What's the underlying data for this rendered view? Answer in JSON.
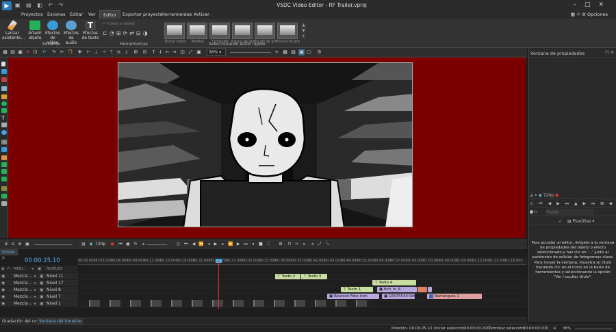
{
  "app": {
    "title": "VSDC Video Editor - RF Trailer.vproj",
    "logo_icon": "vsdc-logo-icon",
    "window_controls": [
      "minimize-icon",
      "maximize-icon",
      "close-icon"
    ]
  },
  "menu": {
    "items": [
      "Proyectos",
      "Escenas",
      "Editar",
      "Ver",
      "Editor",
      "Exportar proyecto",
      "Herramientas",
      "Activar"
    ],
    "active": "Editor",
    "options_label": "Opciones"
  },
  "ribbon": {
    "wizard_label": "Lanzar asistente...",
    "add_object_label": "Añadir objeto",
    "video_effects_label": "Efectos de vídeo",
    "audio_effects_label": "Efectos de audio",
    "text_effects_label": "Efectos de texto",
    "editing_group_label": "Editando",
    "cut_split_label": "Cortar y dividir",
    "tools_group_label": "Herramientas",
    "styles": [
      "Quitar todos",
      "Niveles",
      "Contraste",
      "Escala de gris",
      "Escala de gris",
      "Escala de gris"
    ],
    "quick_style_group_label": "Seleccionando estilo rápido"
  },
  "toolbar": {
    "zoom_value": "36%"
  },
  "properties": {
    "title": "Ventana de propiedades",
    "resolution": "720p",
    "point_placeholder": "Punto",
    "templates_label": "Plantillas",
    "help_text_1": "Para acceder al editor, dirígete a la ventana de propiedades del objeto o efecto seleccionado y haz clic en '...' junto al parámetro de edición de fotogramas clave.",
    "help_text_2": "Para mover la ventana, muestra su título haciendo clic en el icono en la barra de herramientas y seleccionando la opción \"Ver / ocultar título\"."
  },
  "playback": {
    "resolution": "720p"
  },
  "timeline": {
    "scene_tab": "Scene 0",
    "timecode": "00:00:25.10",
    "header_mode": "MOD...",
    "header_levels": "NIVELES",
    "ticks": [
      "00:00.000",
      "00:03.000",
      "00:06.000",
      "00:09.000",
      "00:12.000",
      "00:15.000",
      "00:18.000",
      "00:21.000",
      "00:24.000",
      "00:27.000",
      "00:30.000",
      "00:33.000",
      "00:36.000",
      "00:39.000",
      "00:42.000",
      "00:45.000",
      "00:48.000",
      "00:51.000",
      "00:54.000",
      "00:57.000",
      "01:00.000",
      "01:03.000",
      "01:06.000",
      "01:09.000",
      "01:12.000",
      "01:15.000",
      "01:18.000"
    ],
    "tracks": [
      {
        "mode": "Mezcla",
        "name": "Nivel 11"
      },
      {
        "mode": "Mezcla",
        "name": "Nivel 17"
      },
      {
        "mode": "Mezcla",
        "name": "Nivel 8"
      },
      {
        "mode": "Mezcla",
        "name": "Nivel 7"
      },
      {
        "mode": "Mezcla",
        "name": "Nivel 1"
      }
    ],
    "clips": {
      "texto2": "Texto 2",
      "texto3": "Texto 3",
      "texto4": "Texto 4",
      "texto1": "Texto 1",
      "itch": "Itch_io_4",
      "reunion": "Reunion Fate Icon",
      "image2": "18375544-9kf",
      "rect": "Rectángulo 1"
    }
  },
  "bottom_tabs": [
    "Gradación del color",
    "Ventana del timeline"
  ],
  "status": {
    "position_label": "Posición:",
    "position_value": "00:00:25.10",
    "sel_start_label": "Iniciar selección:",
    "sel_start_value": "00:00:00.000",
    "sel_end_label": "Terminar selección:",
    "sel_end_value": "00:00:00.000",
    "zoom": "36%"
  },
  "colors": {
    "canvas_bg": "#7a0000",
    "accent": "#4fa8e8",
    "playhead": "#e03030",
    "text_clip": "#c8dca0",
    "image_clip": "#b8a8e0",
    "rect_clip": "#e0a0a0"
  }
}
